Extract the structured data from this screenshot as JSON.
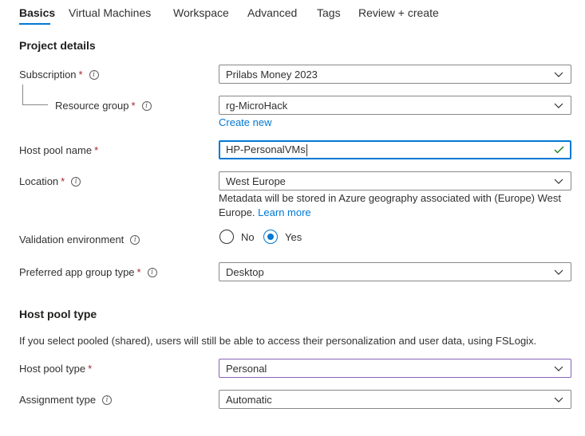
{
  "tabs": [
    "Basics",
    "Virtual Machines",
    "Workspace",
    "Advanced",
    "Tags",
    "Review + create"
  ],
  "project_details": {
    "title": "Project details",
    "subscription": {
      "label": "Subscription",
      "required": "*",
      "value": "Prilabs Money 2023"
    },
    "resource_group": {
      "label": "Resource group",
      "required": "*",
      "value": "rg-MicroHack",
      "create_new": "Create new"
    },
    "host_pool_name": {
      "label": "Host pool name",
      "required": "*",
      "value": "HP-PersonalVMs"
    },
    "location": {
      "label": "Location",
      "required": "*",
      "value": "West Europe",
      "note": "Metadata will be stored in Azure geography associated with (Europe) West Europe.",
      "learn_more": "Learn more"
    },
    "validation_environment": {
      "label": "Validation environment",
      "options": [
        "No",
        "Yes"
      ],
      "selected": "Yes"
    },
    "preferred_app_group_type": {
      "label": "Preferred app group type",
      "required": "*",
      "value": "Desktop"
    }
  },
  "host_pool_type_section": {
    "title": "Host pool type",
    "description": "If you select pooled (shared), users will still be able to access their personalization and user data, using FSLogix.",
    "host_pool_type": {
      "label": "Host pool type",
      "required": "*",
      "value": "Personal"
    },
    "assignment_type": {
      "label": "Assignment type",
      "value": "Automatic"
    }
  },
  "colors": {
    "accent": "#0078d4",
    "required": "#a4262c",
    "success": "#107c10",
    "focus_purple": "#8764b8"
  },
  "icons": {
    "info": "info-icon",
    "dropdown": "chevron-down-icon",
    "valid": "checkmark-icon"
  }
}
